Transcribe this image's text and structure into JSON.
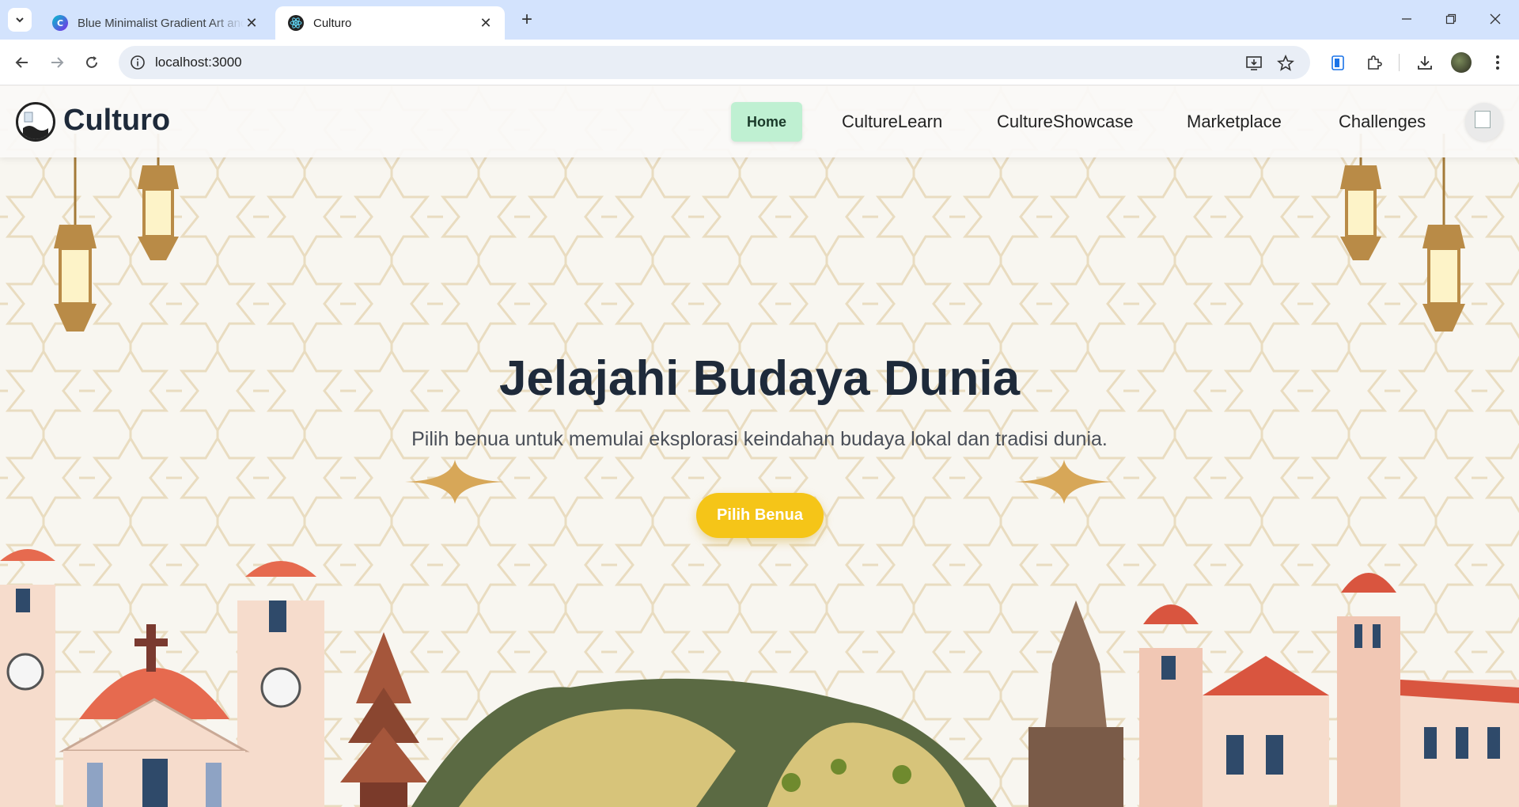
{
  "browser": {
    "tabs": [
      {
        "title": "Blue Minimalist Gradient Art and",
        "active": false
      },
      {
        "title": "Culturo",
        "active": true
      }
    ],
    "url": "localhost:3000"
  },
  "site": {
    "brand": "Culturo",
    "nav": [
      {
        "label": "Home",
        "active": true
      },
      {
        "label": "CultureLearn"
      },
      {
        "label": "CultureShowcase"
      },
      {
        "label": "Marketplace"
      },
      {
        "label": "Challenges"
      }
    ]
  },
  "hero": {
    "title": "Jelajahi Budaya Dunia",
    "subtitle": "Pilih benua untuk memulai eksplorasi keindahan budaya lokal dan tradisi dunia.",
    "cta": "Pilih Benua"
  },
  "colors": {
    "accent": "#f5c518",
    "nav_active_bg": "#bff0d2",
    "heading": "#1e2a3a",
    "tabbar": "#d3e3fd"
  },
  "icons": [
    "tab-search-icon",
    "canva-icon",
    "react-icon",
    "close-icon",
    "plus-icon",
    "minimize-icon",
    "restore-icon",
    "window-close-icon",
    "back-icon",
    "forward-icon",
    "reload-icon",
    "info-icon",
    "install-icon",
    "star-icon",
    "clipboard-icon",
    "extensions-icon",
    "download-icon",
    "profile-avatar",
    "more-icon"
  ]
}
